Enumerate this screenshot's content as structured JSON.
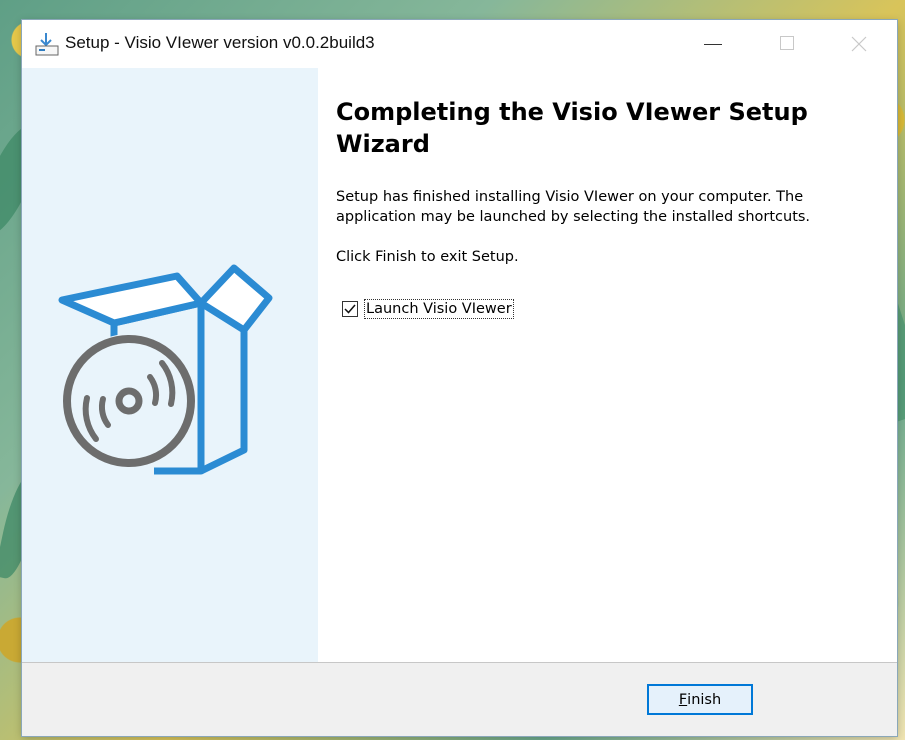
{
  "window": {
    "title": "Setup - Visio VIewer version v0.0.2build3"
  },
  "sidebar": {
    "illustration_icon": "software-box-with-disc-icon"
  },
  "content": {
    "heading": "Completing the Visio VIewer Setup Wizard",
    "paragraph1": "Setup has finished installing Visio VIewer on your computer. The application may be launched by selecting the installed shortcuts.",
    "paragraph2": "Click Finish to exit Setup.",
    "launch_checkbox": {
      "label": "Launch Visio VIewer",
      "checked": true
    }
  },
  "footer": {
    "finish_button": {
      "mnemonic": "F",
      "rest": "inish"
    }
  },
  "icons": {
    "app": "setup-download-icon",
    "minimize": "minimize-icon",
    "maximize": "maximize-icon",
    "close": "close-icon",
    "checkmark": "checkmark-icon"
  },
  "colors": {
    "accent_blue": "#2b8bd3",
    "sidebar_bg": "#e9f4fb",
    "disc_gray": "#6d6d6d",
    "focus_blue": "#0078d7",
    "footer_bg": "#f0f0f0"
  }
}
